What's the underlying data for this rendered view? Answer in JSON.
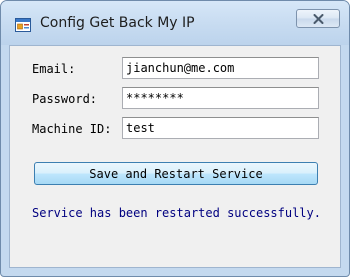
{
  "window": {
    "title": "Config Get Back My IP",
    "app_icon": "form-window-icon",
    "close_icon": "close-icon"
  },
  "form": {
    "email_label": "Email:",
    "email_value": "jianchun@me.com",
    "password_label": "Password:",
    "password_value": "********",
    "machine_label": "Machine ID:",
    "machine_value": "test"
  },
  "actions": {
    "save_label": "Save and Restart Service"
  },
  "status": {
    "message": "Service has been restarted successfully.",
    "color": "#000080"
  }
}
